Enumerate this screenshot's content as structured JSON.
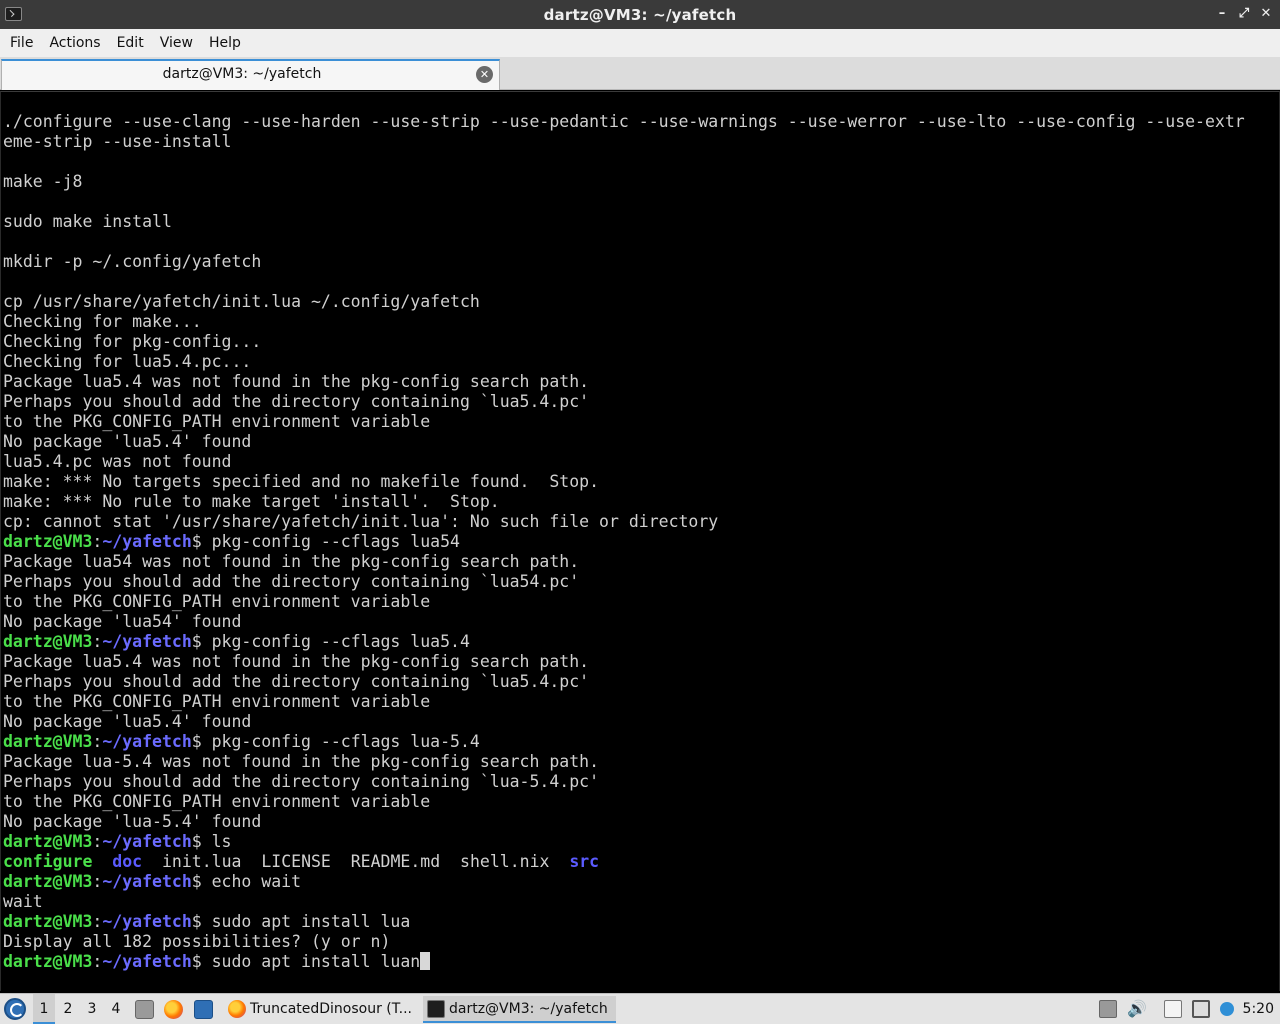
{
  "window": {
    "title": "dartz@VM3: ~/yafetch",
    "controls": {
      "minimize": "–",
      "maximize": "⤢",
      "close": "✕"
    }
  },
  "menu": [
    "File",
    "Actions",
    "Edit",
    "View",
    "Help"
  ],
  "tab": {
    "label": "dartz@VM3: ~/yafetch",
    "close": "✕"
  },
  "terminal": {
    "prompt_user": "dartz@VM3",
    "prompt_sep": ":",
    "prompt_path": "~/yafetch",
    "prompt_end": "$ ",
    "lines": [
      {
        "t": "out",
        "text": "./configure --use-clang --use-harden --use-strip --use-pedantic --use-warnings --use-werror --use-lto --use-config --use-extr"
      },
      {
        "t": "out",
        "text": "eme-strip --use-install"
      },
      {
        "t": "out",
        "text": ""
      },
      {
        "t": "out",
        "text": "make -j8"
      },
      {
        "t": "out",
        "text": ""
      },
      {
        "t": "out",
        "text": "sudo make install"
      },
      {
        "t": "out",
        "text": ""
      },
      {
        "t": "out",
        "text": "mkdir -p ~/.config/yafetch"
      },
      {
        "t": "out",
        "text": ""
      },
      {
        "t": "out",
        "text": "cp /usr/share/yafetch/init.lua ~/.config/yafetch"
      },
      {
        "t": "out",
        "text": "Checking for make..."
      },
      {
        "t": "out",
        "text": "Checking for pkg-config..."
      },
      {
        "t": "out",
        "text": "Checking for lua5.4.pc..."
      },
      {
        "t": "out",
        "text": "Package lua5.4 was not found in the pkg-config search path."
      },
      {
        "t": "out",
        "text": "Perhaps you should add the directory containing `lua5.4.pc'"
      },
      {
        "t": "out",
        "text": "to the PKG_CONFIG_PATH environment variable"
      },
      {
        "t": "out",
        "text": "No package 'lua5.4' found"
      },
      {
        "t": "out",
        "text": "lua5.4.pc was not found"
      },
      {
        "t": "out",
        "text": "make: *** No targets specified and no makefile found.  Stop."
      },
      {
        "t": "out",
        "text": "make: *** No rule to make target 'install'.  Stop."
      },
      {
        "t": "out",
        "text": "cp: cannot stat '/usr/share/yafetch/init.lua': No such file or directory"
      },
      {
        "t": "cmd",
        "text": "pkg-config --cflags lua54"
      },
      {
        "t": "out",
        "text": "Package lua54 was not found in the pkg-config search path."
      },
      {
        "t": "out",
        "text": "Perhaps you should add the directory containing `lua54.pc'"
      },
      {
        "t": "out",
        "text": "to the PKG_CONFIG_PATH environment variable"
      },
      {
        "t": "out",
        "text": "No package 'lua54' found"
      },
      {
        "t": "cmd",
        "text": "pkg-config --cflags lua5.4"
      },
      {
        "t": "out",
        "text": "Package lua5.4 was not found in the pkg-config search path."
      },
      {
        "t": "out",
        "text": "Perhaps you should add the directory containing `lua5.4.pc'"
      },
      {
        "t": "out",
        "text": "to the PKG_CONFIG_PATH environment variable"
      },
      {
        "t": "out",
        "text": "No package 'lua5.4' found"
      },
      {
        "t": "cmd",
        "text": "pkg-config --cflags lua-5.4"
      },
      {
        "t": "out",
        "text": "Package lua-5.4 was not found in the pkg-config search path."
      },
      {
        "t": "out",
        "text": "Perhaps you should add the directory containing `lua-5.4.pc'"
      },
      {
        "t": "out",
        "text": "to the PKG_CONFIG_PATH environment variable"
      },
      {
        "t": "out",
        "text": "No package 'lua-5.4' found"
      },
      {
        "t": "cmd",
        "text": "ls"
      },
      {
        "t": "ls",
        "items": [
          {
            "name": "configure",
            "kind": "green",
            "gap": "  "
          },
          {
            "name": "doc",
            "kind": "blue",
            "gap": "  "
          },
          {
            "name": "init.lua",
            "kind": "file",
            "gap": "  "
          },
          {
            "name": "LICENSE",
            "kind": "file",
            "gap": "  "
          },
          {
            "name": "README.md",
            "kind": "file",
            "gap": "  "
          },
          {
            "name": "shell.nix",
            "kind": "file",
            "gap": "  "
          },
          {
            "name": "src",
            "kind": "blue",
            "gap": ""
          }
        ]
      },
      {
        "t": "cmd",
        "text": "echo wait"
      },
      {
        "t": "out",
        "text": "wait"
      },
      {
        "t": "cmd",
        "text": "sudo apt install lua"
      },
      {
        "t": "out",
        "text": "Display all 182 possibilities? (y or n)"
      },
      {
        "t": "cmd",
        "text": "sudo apt install luan",
        "cursor": true
      }
    ]
  },
  "taskbar": {
    "workspaces": [
      "1",
      "2",
      "3",
      "4"
    ],
    "active_workspace": "1",
    "quicklaunch": [
      "file-manager-icon",
      "firefox-icon",
      "desktop-icon"
    ],
    "tasks": [
      {
        "label": "TruncatedDinosour (T...",
        "icon": "firefox-icon"
      },
      {
        "label": "dartz@VM3: ~/yafetch",
        "icon": "terminal-icon",
        "active": true
      }
    ],
    "tray": [
      "keyboard-icon",
      "volume-icon",
      "clipboard-icon",
      "network-icon",
      "update-icon"
    ],
    "clock": "5:20"
  }
}
